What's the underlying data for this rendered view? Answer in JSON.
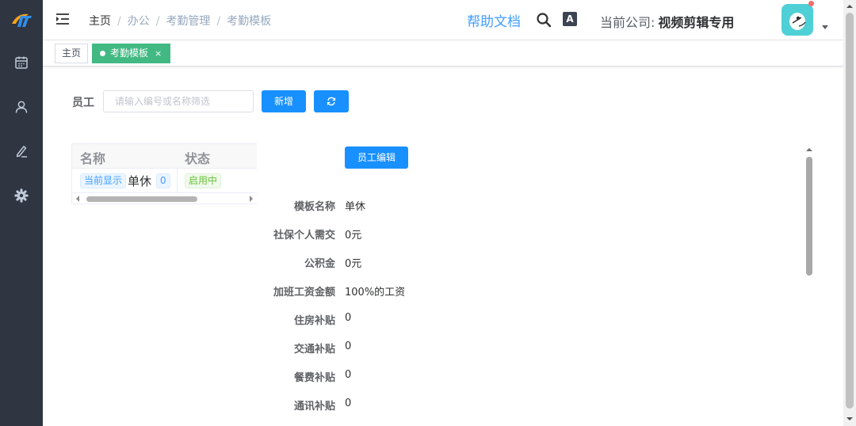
{
  "breadcrumb": [
    "主页",
    "办公",
    "考勤管理",
    "考勤模板"
  ],
  "header": {
    "help_label": "帮助文档",
    "company_label": "当前公司:",
    "company_name": "视频剪辑专用"
  },
  "sidebar": {
    "items": [
      "calendar-icon",
      "user-icon",
      "edit-icon",
      "gear-icon"
    ]
  },
  "tags": {
    "home": "主页",
    "active": "考勤模板",
    "close": "×"
  },
  "filter": {
    "label": "员工",
    "placeholder": "请输入编号或名称筛选",
    "add_label": "新增",
    "refresh_icon": "refresh-icon"
  },
  "table": {
    "headers": [
      "名称",
      "状态"
    ],
    "rows": [
      {
        "badge": "当前显示",
        "name": "单休",
        "count": "0",
        "status": "启用中"
      }
    ]
  },
  "detail": {
    "edit_label": "员工编辑",
    "fields": [
      {
        "label": "模板名称",
        "value": "单休"
      },
      {
        "label": "社保个人需交",
        "value": "0元"
      },
      {
        "label": "公积金",
        "value": "0元"
      },
      {
        "label": "加班工资金额",
        "value": "100%的工资"
      },
      {
        "label": "住房补贴",
        "value": "0"
      },
      {
        "label": "交通补贴",
        "value": "0"
      },
      {
        "label": "餐费补贴",
        "value": "0"
      },
      {
        "label": "通讯补贴",
        "value": "0"
      }
    ]
  },
  "colors": {
    "sidebar": "#2f3541",
    "primary": "#1890ff",
    "tag_active": "#42b983",
    "link": "#409eff"
  }
}
